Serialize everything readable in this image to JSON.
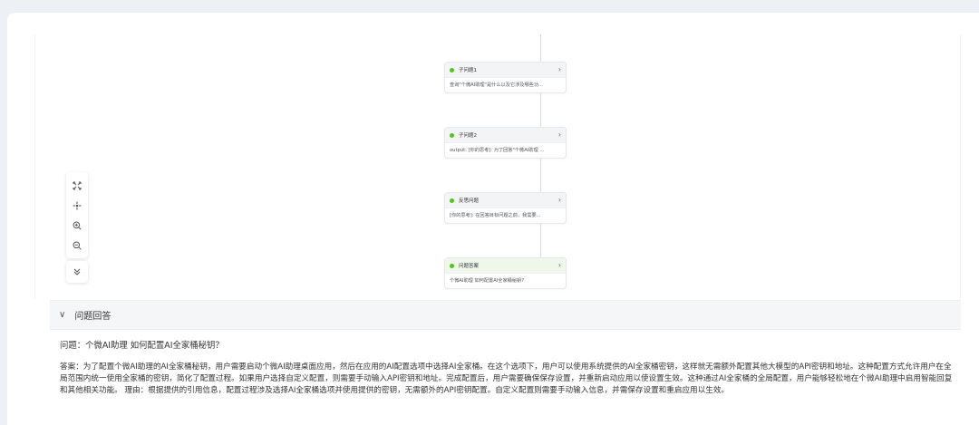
{
  "flow": {
    "nodes": [
      {
        "title": "子问题1",
        "body": "查询\"个微AI助理\"是什么以及它涉及哪些功...",
        "done": false
      },
      {
        "title": "子问题2",
        "body": "output: [你的思考]: 为了回答\"个微AI助理 ...",
        "done": false
      },
      {
        "title": "反思问题",
        "body": "[你的思考]: 在回答目标问题之前，我需要...",
        "done": false
      },
      {
        "title": "问题答案",
        "body": "个微AI助理 如何配置AI全家桶秘钥?",
        "done": true
      }
    ],
    "status_color": "#52c41a"
  },
  "toolbar": {
    "icons": [
      "fit-view-icon",
      "center-icon",
      "zoom-in-icon",
      "zoom-out-icon"
    ],
    "collapse_icon": "double-chevron-down-icon"
  },
  "answer_section": {
    "title": "问题回答",
    "question": "问题：个微AI助理 如何配置AI全家桶秘钥？",
    "answer": "答案：为了配置个微AI助理的AI全家桶秘钥，用户需要启动个微AI助理桌面应用，然后在应用的AI配置选项中选择AI全家桶。在这个选项下，用户可以使用系统提供的AI全家桶密钥，这样就无需额外配置其他大模型的API密钥和地址。这种配置方式允许用户在全局范围内统一使用全家桶的密钥，简化了配置过程。如果用户选择自定义配置，则需要手动输入API密钥和地址。完成配置后，用户需要确保保存设置，并重新启动应用以使设置生效。这种通过AI全家桶的全局配置，用户能够轻松地在个微AI助理中启用智能回复和其他相关功能。 理由：根据提供的引用信息，配置过程涉及选择AI全家桶选项并使用提供的密钥，无需额外的API密钥配置。自定义配置则需要手动输入信息，并需保存设置和重启应用以生效。"
  }
}
